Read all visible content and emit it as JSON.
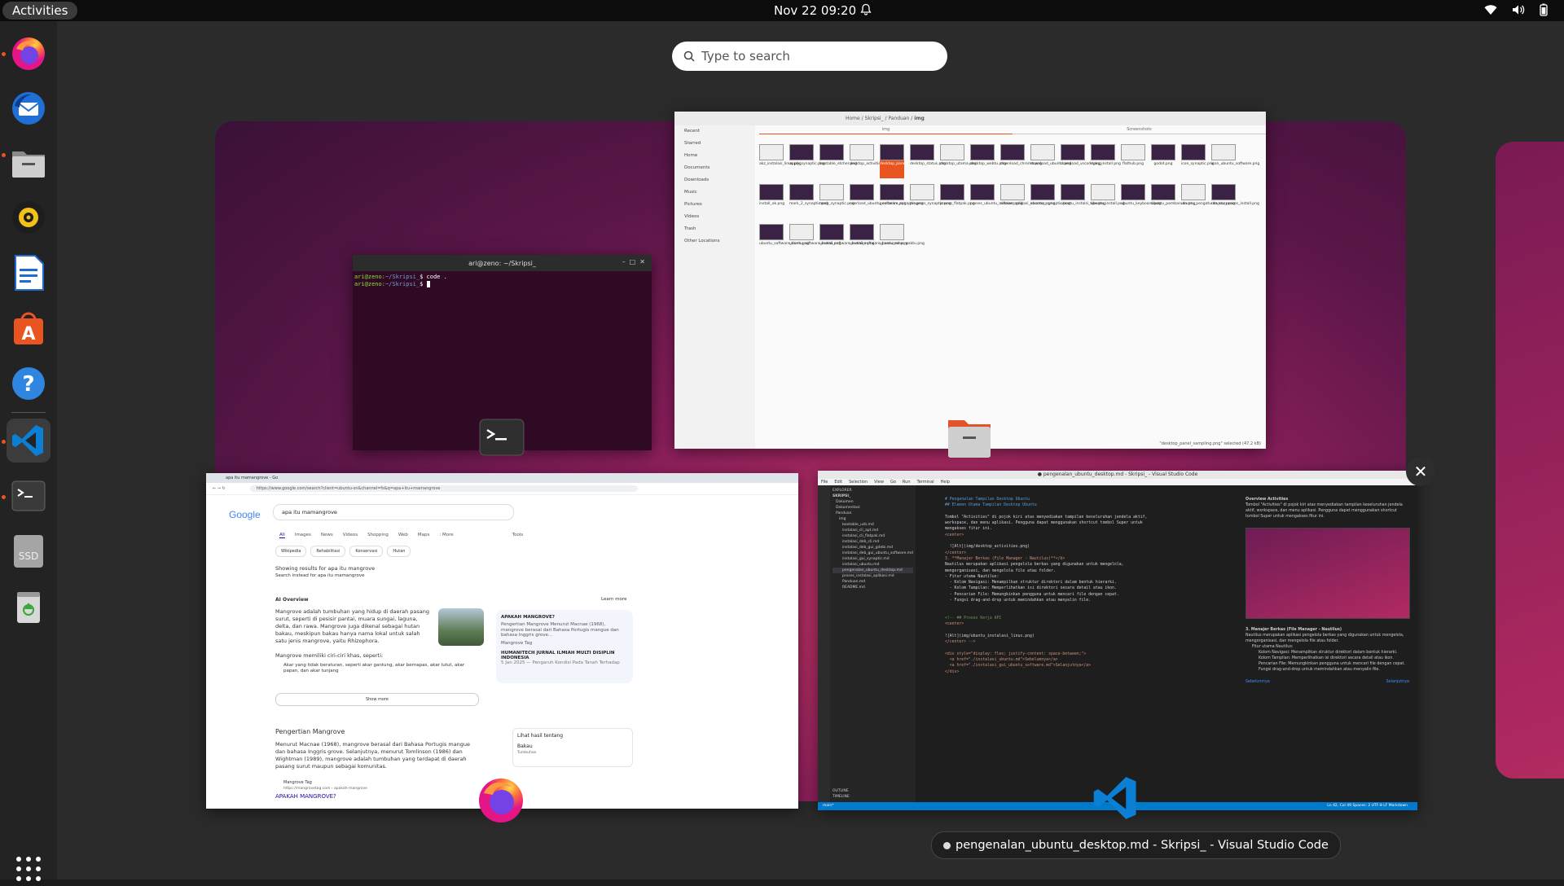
{
  "topbar": {
    "activities_label": "Activities",
    "datetime": "Nov 22  09:20"
  },
  "dock": {
    "items": [
      {
        "name": "Firefox",
        "icon": "firefox-icon",
        "running": true
      },
      {
        "name": "Thunderbird",
        "icon": "thunderbird-icon",
        "running": false
      },
      {
        "name": "Files",
        "icon": "files-icon",
        "running": true
      },
      {
        "name": "Rhythmbox",
        "icon": "rhythmbox-icon",
        "running": false
      },
      {
        "name": "LibreOffice Writer",
        "icon": "writer-icon",
        "running": false
      },
      {
        "name": "Ubuntu Software",
        "icon": "software-icon",
        "running": false
      },
      {
        "name": "Help",
        "icon": "help-icon",
        "running": false
      },
      {
        "name": "Visual Studio Code",
        "icon": "vscode-icon",
        "running": true,
        "active": true
      },
      {
        "name": "Terminal",
        "icon": "terminal-icon",
        "running": true
      },
      {
        "name": "SSD",
        "icon": "ssd-drive-icon",
        "label": "SSD",
        "running": false
      },
      {
        "name": "Trash",
        "icon": "trash-icon",
        "running": false
      }
    ],
    "show_apps_icon": "show-applications-icon"
  },
  "search": {
    "placeholder": "Type to search"
  },
  "windows": {
    "terminal": {
      "title": "ari@zeno: ~/Skripsi_",
      "line1_prompt": "ari@zeno:",
      "line1_path": "~/Skripsi_",
      "line1_cmd": "$ code .",
      "line2_prompt": "ari@zeno:",
      "line2_path": "~/Skripsi_",
      "line2_cmd": "$ "
    },
    "files": {
      "breadcrumb": [
        "Home",
        "Skripsi_",
        "Panduan",
        "img"
      ],
      "tabs": [
        "img",
        "Screenshots"
      ],
      "sidebar": [
        "Recent",
        "Starred",
        "Home",
        "Documents",
        "Downloads",
        "Music",
        "Pictures",
        "Videos",
        "Trash",
        "Other Locations"
      ],
      "files": [
        "akz_instalasi_linux.png",
        "apply_synaptic.png",
        "bootable_etcher.png",
        "desktop_activities.png",
        "desktop_panel_sampling.png",
        "desktop_status.png",
        "desktop_utama.png",
        "desktop_webtu.png",
        "download_chrome.png",
        "download_ubuntu.png",
        "download_vscode.png",
        "dpkg_install.png",
        "flathub.png",
        "godot.png",
        "icon_synaptic.png",
        "icon_ubuntu_software.png",
        "install_ok.png",
        "mark_2_synaptic.png",
        "mark_synaptic.png",
        "overload_ubuntu_software.png",
        "pencarian_synaptic.png",
        "progress_synaptic.png",
        "proses_flatpak.png",
        "proses_ubuntu_software.png",
        "rincian_aplikasi_ubuntu_s.png",
        "success_synaptic.png",
        "ubuntu_instalsi_tipe.png",
        "ubuntu_install.png",
        "ubuntu_keyboard.png",
        "ubuntu_pembaruan.png",
        "ubuntu_pengaturan_user.png",
        "ubuntu_proses_install.png",
        "ubuntu_software_done.png",
        "ubuntu_software_install.png",
        "ubuntu_software_installer.png",
        "ubuntu_software_password.png",
        "ubuntu_zona_waktu.png"
      ],
      "status": "\"desktop_panel_sampling.png\" selected (47.2 kB)"
    },
    "browser": {
      "tab_title": "apa itu mamangrove - Go",
      "url": "https://www.google.com/search?client=ubuntu-sn&channel=fs&q=apa+itu+mamangrove",
      "logo": "Google",
      "query": "apa itu mamangrove",
      "search_tabs": [
        "All",
        "Images",
        "News",
        "Videos",
        "Shopping",
        "Web",
        "Maps",
        ": More",
        "Tools"
      ],
      "chips": [
        "Wikipedia",
        "Rehabilitasi",
        "Konservasi",
        "Hutan"
      ],
      "showing_results": "Showing results for apa itu mangrove",
      "search_instead": "Search instead for apa itu mamangrove",
      "ai_overview_label": "AI Overview",
      "learn_more": "Learn more",
      "ai_text": "Mangrove adalah tumbuhan yang hidup di daerah pasang surut, seperti di pesisir pantai, muara sungai, laguna, delta, dan rawa. Mangrove juga dikenal sebagai hutan bakau, meskipun bakau hanya nama lokal untuk salah satu jenis mangrove, yaitu Rhizophora.",
      "ai_sub": "Mangrove memiliki ciri-ciri khas, seperti:",
      "ai_bullet": "Akar yang tidak beraturan, seperti akar gantung, akar bernapas, akar lutut, akar papan, dan akar tunjang",
      "card1_title": "APAKAH MANGROVE?",
      "card1_text": "Pengertian Mangrove Menurut Macnae (1968), mangrove berasal dari Bahasa Portugis mangue dan bahasa Inggris grove...",
      "card1_source": "Mangrove Tag",
      "card2_title": "HUMANITECH JURNAL ILMIAH MULTI DISIPLIN INDONESIA",
      "card2_date": "5 Jan 2025 — Pengaruh Kondisi Pada Tanah Terhadap",
      "show_more": "Show more",
      "section_title": "Pengertian Mangrove",
      "section_text": "Menurut Macnae (1968), mangrove berasal dari Bahasa Portugis mangue dan bahasa Inggris grove. Selanjutnya, menurut Tomlinson (1986) dan Wightman (1989), mangrove adalah tumbuhan yang terdapat di daerah pasang surut maupun sebagai komunitas.",
      "result_site": "Mangrove Tag",
      "result_url": "https://mangrovetag.com › apakah-mangrove",
      "result_title": "APAKAH MANGROVE?",
      "side_title": "Lihat hasil tentang",
      "side_item": "Bakau",
      "side_item_sub": "Tumbuhan"
    },
    "vscode": {
      "title": "● pengenalan_ubuntu_desktop.md - Skripsi_ - Visual Studio Code",
      "menu": [
        "File",
        "Edit",
        "Selection",
        "View",
        "Go",
        "Run",
        "Terminal",
        "Help"
      ],
      "explorer_label": "EXPLORER",
      "project": "SKRIPSI_",
      "tree": [
        "Dokumen",
        "Dokumentasi",
        "Panduan",
        "img",
        "bootable_usb.md",
        "instalasi_cli_apt.md",
        "instalasi_cli_flatpak.md",
        "instalasi_deb_cli.md",
        "instalasi_deb_gui_gdebi.md",
        "instalasi_deb_gui_ubuntu_software.md",
        "instalasi_gui_synaptic.md",
        "instalasi_ubuntu.md",
        "pengenalan_ubuntu_desktop.md",
        "proses_instalasi_aplikasi.md",
        "Panduan.md",
        "README.md"
      ],
      "outline_label": "OUTLINE",
      "timeline_label": "TIMELINE",
      "code_lines": [
        "# Pengenalan Tampilan Desktop Ubuntu",
        "## Elemen Utama Tampilan Desktop Ubuntu",
        "",
        "Tombol \"Activities\" di pojok kiri atas menyediakan tampilan keseluruhan jendela aktif,",
        "workspace, dan menu aplikasi. Pengguna dapat menggunakan shortcut tombol Super untuk",
        "mengakses fitur ini.",
        "<center>",
        "",
        "  ![Alt](img/desktop_activities.png)",
        "</center>",
        "3. **Manajer Berkas (File Manager - Nautilus)**</b>",
        "Nautilus merupakan aplikasi pengelola berkas yang digunakan untuk mengelola,",
        "mengorganisasi, dan mengelola file atau folder.",
        "- Fitur utama Nautilus:",
        "  - Kolom Navigasi: Menampilkan struktur direktori dalam bentuk hierarki.",
        "  - Kolom Tampilan: Memperlihatkan isi direktori secara detail atau ikon.",
        "  - Pencarian File: Memungkinkan pengguna untuk mencari file dengan cepat.",
        "  - Fungsi drag-and-drop untuk memindahkan atau menyalin file.",
        "",
        "",
        "<!-- ## Proses Kerja API",
        "<center>",
        "",
        "![Alt](img/ubuntu_instalasi_linux.png)",
        "</center> -->",
        "",
        "<div style=\"display: flex; justify-content: space-between;\">",
        "  <a href=\"./instalasi_ubuntu.md\">Sebelumnya</a>",
        "  <a href=\"./instalasi_gui_ubuntu_software.md\">Selanjutnya</a>",
        "</div>"
      ],
      "preview_heading": "Overview Activities",
      "preview_text": "Tombol \"Activities\" di pojok kiri atas menyediakan tampilan keseluruhan jendela aktif, workspace, dan menu aplikasi. Pengguna dapat menggunakan shortcut tombol Super untuk mengakses fitur ini.",
      "preview_h3": "3. Manajer Berkas (File Manager - Nautilus)",
      "preview_p3": "Nautilus merupakan aplikasi pengelola berkas yang digunakan untuk mengelola, mengorganisasi, dan mengelola file atau folder.",
      "preview_list": [
        "Fitur utama Nautilus:",
        "Kolom Navigasi: Menampilkan struktur direktori dalam bentuk hierarki.",
        "Kolom Tampilan: Memperlihatkan isi direktori secara detail atau ikon.",
        "Pencarian File: Memungkinkan pengguna untuk mencari file dengan cepat.",
        "Fungsi drag-and-drop untuk memindahkan atau menyalin file."
      ],
      "preview_prev": "Sebelumnya",
      "preview_next": "Selanjutnya",
      "status_branch": "main*",
      "status_right": "Ln 42, Col 49   Spaces: 2   UTF-8   LF   Markdown"
    }
  },
  "caption": {
    "text": "pengenalan_ubuntu_desktop.md - Skripsi_ - Visual Studio Code"
  },
  "colors": {
    "accent": "#e95420",
    "vscode_blue": "#007acc",
    "wallpaper": "#8c1f5d"
  }
}
